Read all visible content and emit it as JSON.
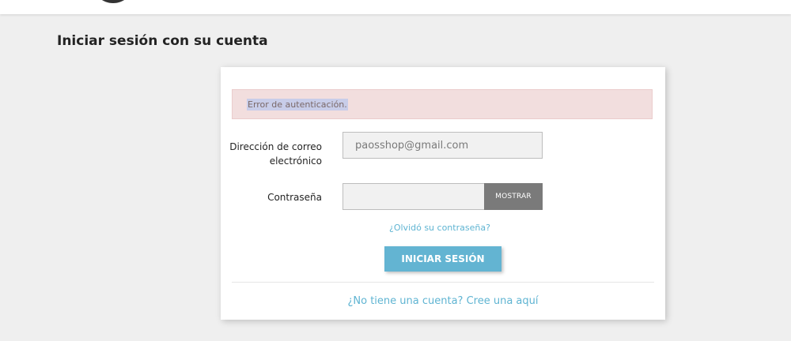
{
  "header": {
    "logo_icon": "logo-icon"
  },
  "page": {
    "title": "Iniciar sesión con su cuenta"
  },
  "login_form": {
    "error_message": "Error de autenticación.",
    "email_label": "Dirección de correo electrónico",
    "email_value": "paosshop@gmail.com",
    "password_label": "Contraseña",
    "password_value": "",
    "show_password_label": "MOSTRAR",
    "forgot_password_link": "¿Olvidó su contraseña?",
    "submit_label": "INICIAR SESIÓN",
    "register_link": "¿No tiene una cuenta? Cree una aquí"
  },
  "colors": {
    "accent": "#63b4d2",
    "error_background": "#f2dede",
    "show_button_background": "#7a7a7a",
    "page_background": "#efefef"
  }
}
